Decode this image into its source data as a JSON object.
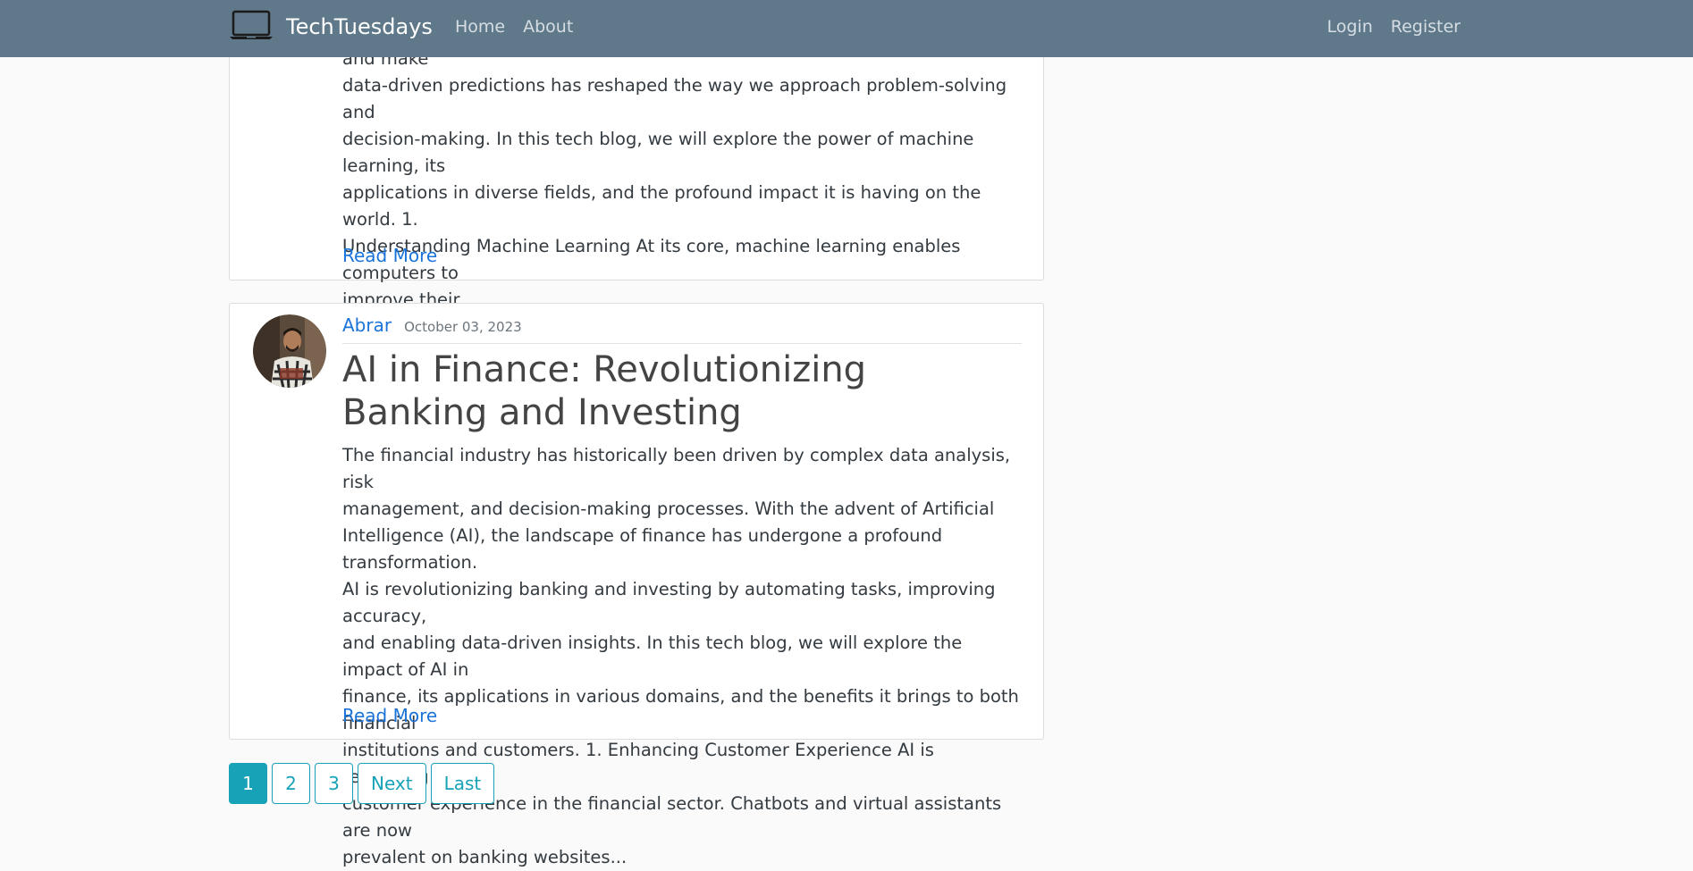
{
  "navbar": {
    "brand": "TechTuesdays",
    "brand_icon": "laptop-icon",
    "links_left": [
      "Home",
      "About"
    ],
    "links_right": [
      "Login",
      "Register"
    ],
    "background": "#5f788a"
  },
  "articles": [
    {
      "excerpt_lines": [
        "explicit programming. Its ability to analyze vast datasets, identify patterns, and make",
        "data-driven predictions has reshaped the way we approach problem-solving and",
        "decision-making. In this tech blog, we will explore the power of machine learning, its",
        "applications in diverse fields, and the profound impact it is having on the world. 1.",
        "Understanding Machine Learning At its core, machine learning enables computers to",
        "improve their..."
      ],
      "read_more": "Read More"
    },
    {
      "author": "Abrar",
      "date": "October 03, 2023",
      "title": "AI in Finance: Revolutionizing Banking and Investing",
      "excerpt_lines": [
        "The financial industry has historically been driven by complex data analysis, risk",
        "management, and decision-making processes. With the advent of Artificial",
        "Intelligence (AI), the landscape of finance has undergone a profound transformation.",
        "AI is revolutionizing banking and investing by automating tasks, improving accuracy,",
        "and enabling data-driven insights. In this tech blog, we will explore the impact of AI in",
        "finance, its applications in various domains, and the benefits it brings to both financial",
        "institutions and customers. 1. Enhancing Customer Experience AI is reshaping the",
        "customer experience in the financial sector. Chatbots and virtual assistants are now",
        "prevalent on banking websites..."
      ],
      "read_more": "Read More"
    }
  ],
  "pagination": {
    "pages": [
      "1",
      "2",
      "3"
    ],
    "next": "Next",
    "last": "Last",
    "active_page": "1",
    "accent": "#17a2b8"
  }
}
